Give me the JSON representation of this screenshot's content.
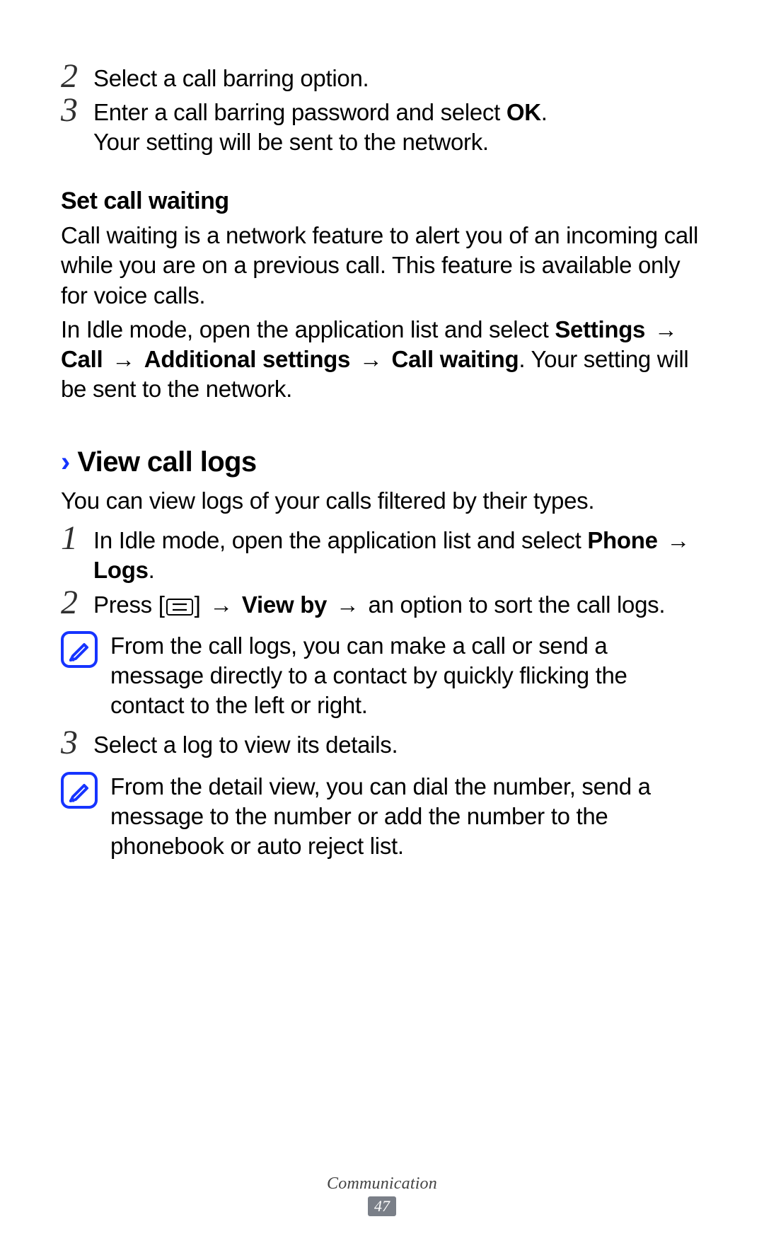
{
  "arrow": "→",
  "top_steps": {
    "n2": "2",
    "s2": "Select a call barring option.",
    "n3": "3",
    "s3a": "Enter a call barring password and select ",
    "s3b": "OK",
    "s3c": ".",
    "s3d": "Your setting will be sent to the network."
  },
  "set_waiting": {
    "heading": "Set call waiting",
    "p1": "Call waiting is a network feature to alert you of an incoming call while you are on a previous call. This feature is available only for voice calls.",
    "p2a": "In Idle mode, open the application list and select ",
    "p2_settings": "Settings",
    "p2_call": "Call",
    "p2_additional": "Additional settings",
    "p2_callwaiting": "Call waiting",
    "p2_tail": ". Your setting will be sent to the network."
  },
  "view_logs": {
    "chevron": "›",
    "heading": "View call logs",
    "intro": "You can view logs of your calls filtered by their types.",
    "n1": "1",
    "s1a": "In Idle mode, open the application list and select ",
    "s1_phone": "Phone",
    "s1_logs": "Logs",
    "s1_period": ".",
    "n2": "2",
    "s2a": "Press [",
    "s2b": "] ",
    "s2_viewby": "View by",
    "s2_tail": " an option to sort the call logs.",
    "note1": "From the call logs, you can make a call or send a message directly to a contact by quickly flicking the contact to the left or right.",
    "n3": "3",
    "s3": "Select a log to view its details.",
    "note2": "From the detail view, you can dial the number, send a message to the number or add the number to the phonebook or auto reject list."
  },
  "footer": {
    "section": "Communication",
    "page": "47"
  }
}
